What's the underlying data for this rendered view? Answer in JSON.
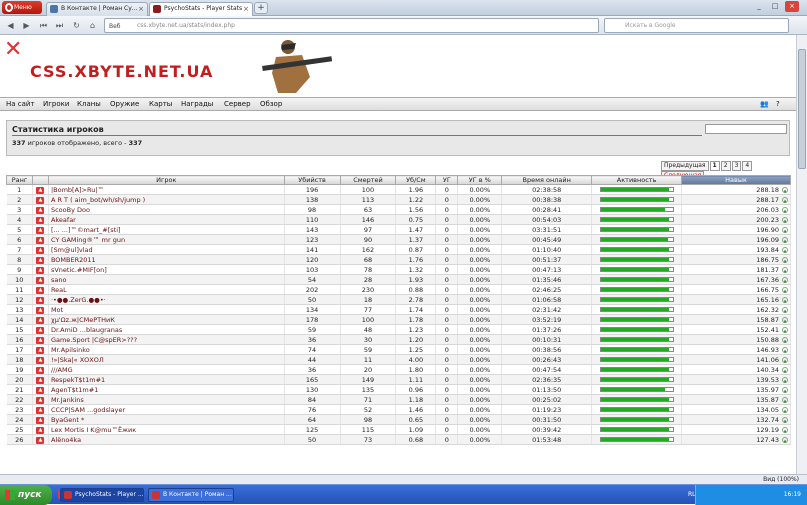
{
  "browser": {
    "menu_label": "Меню",
    "tabs": [
      {
        "label": "В Контакте | Роман Су...",
        "active": false
      },
      {
        "label": "PsychoStats - Player Stats",
        "active": true
      }
    ],
    "address_prefix": "Веб",
    "url": "css.xbyte.net.ua/stats/index.php",
    "search_placeholder": "Искать в Google"
  },
  "site": {
    "name": "CSS.XBYTE.NET.UA",
    "menu": [
      "На сайт",
      "Игроки",
      "Кланы",
      "Оружие",
      "Карты",
      "Награды",
      "Сервер",
      "Обзор"
    ],
    "panel_title": "Статистика игроков",
    "summary_count": "337",
    "summary_text": "игроков отображено, всего -",
    "summary_total": "337",
    "pager": {
      "prev": "Предыдущая",
      "pages": [
        "1",
        "2",
        "3",
        "4"
      ],
      "next": "Следующая"
    }
  },
  "table": {
    "headers": [
      "Ранг",
      "",
      "Игрок",
      "Убийств",
      "Смертей",
      "Уб/См",
      "УГ",
      "УГ в %",
      "Время онлайн",
      "Активность",
      "Навык"
    ],
    "rows": [
      [
        "1",
        "|Bomb[A]>Ru|™",
        "196",
        "100",
        "1.96",
        "0",
        "0.00%",
        "02:38:58",
        95,
        "288.18"
      ],
      [
        "2",
        "A R T ( aim_bot/wh/sh/jump )",
        "138",
        "113",
        "1.22",
        "0",
        "0.00%",
        "00:38:38",
        95,
        "288.17"
      ],
      [
        "3",
        "ScooBy Doo",
        "98",
        "63",
        "1.56",
        "0",
        "0.00%",
        "00:28:41",
        90,
        "206.03"
      ],
      [
        "4",
        "Akeafar",
        "110",
        "146",
        "0.75",
        "0",
        "0.00%",
        "00:54:03",
        95,
        "200.23"
      ],
      [
        "5",
        "[... ...]™©mart_#[sti]",
        "143",
        "97",
        "1.47",
        "0",
        "0.00%",
        "03:31:51",
        95,
        "196.90"
      ],
      [
        "6",
        "CY GAMing®™ mr gun",
        "123",
        "90",
        "1.37",
        "0",
        "0.00%",
        "00:45:49",
        94,
        "196.09"
      ],
      [
        "7",
        "[Sm@ul]vlad",
        "141",
        "162",
        "0.87",
        "0",
        "0.00%",
        "01:10:40",
        95,
        "193.84"
      ],
      [
        "8",
        "BOMBER2011",
        "120",
        "68",
        "1.76",
        "0",
        "0.00%",
        "00:51:37",
        95,
        "186.75"
      ],
      [
        "9",
        "sVnetic.#MIF[on]",
        "103",
        "78",
        "1.32",
        "0",
        "0.00%",
        "00:47:13",
        95,
        "181.37"
      ],
      [
        "10",
        "sano",
        "54",
        "28",
        "1.93",
        "0",
        "0.00%",
        "01:35:46",
        95,
        "167.36"
      ],
      [
        "11",
        "ReaL",
        "202",
        "230",
        "0.88",
        "0",
        "0.00%",
        "02:46:25",
        95,
        "166.75"
      ],
      [
        "12",
        "·•●●.ZerG.●●•·",
        "50",
        "18",
        "2.78",
        "0",
        "0.00%",
        "01:06:58",
        95,
        "165.16"
      ],
      [
        "13",
        "Mot",
        "134",
        "77",
        "1.74",
        "0",
        "0.00%",
        "02:31:42",
        95,
        "162.32"
      ],
      [
        "14",
        "χμ'Ωz.ж|СМеРТНиК",
        "178",
        "100",
        "1.78",
        "0",
        "0.00%",
        "03:52:19",
        95,
        "158.87"
      ],
      [
        "15",
        "Dr.AmiD ...blaugranas",
        "59",
        "48",
        "1.23",
        "0",
        "0.00%",
        "01:37:26",
        95,
        "152.41"
      ],
      [
        "16",
        "Game.Sport |C@spER>???",
        "36",
        "30",
        "1.20",
        "0",
        "0.00%",
        "00:10:31",
        95,
        "150.88"
      ],
      [
        "17",
        "Mr.Apilsinko",
        "74",
        "59",
        "1.25",
        "0",
        "0.00%",
        "00:38:56",
        95,
        "146.93"
      ],
      [
        "18",
        "!»|Ska|« ХОХОЛ",
        "44",
        "11",
        "4.00",
        "0",
        "0.00%",
        "00:26:43",
        95,
        "141.06"
      ],
      [
        "19",
        "///AMG",
        "36",
        "20",
        "1.80",
        "0",
        "0.00%",
        "00:47:54",
        95,
        "140.34"
      ],
      [
        "20",
        "RespekT$t1m#1",
        "165",
        "149",
        "1.11",
        "0",
        "0.00%",
        "02:36:35",
        95,
        "139.53"
      ],
      [
        "21",
        "AgenT$t1m#1",
        "130",
        "135",
        "0.96",
        "0",
        "0.00%",
        "01:13:50",
        90,
        "135.97"
      ],
      [
        "22",
        "Mr.Jankins",
        "84",
        "71",
        "1.18",
        "0",
        "0.00%",
        "00:25:02",
        "95",
        "135.87"
      ],
      [
        "23",
        "CCCP|SAM ...godslayer",
        "76",
        "52",
        "1.46",
        "0",
        "0.00%",
        "01:19:23",
        95,
        "134.05"
      ],
      [
        "24",
        "ByaGent *",
        "64",
        "98",
        "0.65",
        "0",
        "0.00%",
        "00:31:50",
        95,
        "132.74"
      ],
      [
        "25",
        "Lex Mortis I K@mu™Ёжик",
        "125",
        "115",
        "1.09",
        "0",
        "0.00%",
        "00:39:42",
        95,
        "129.19"
      ],
      [
        "26",
        "Alёno4ka",
        "50",
        "73",
        "0.68",
        "0",
        "0.00%",
        "01:53:48",
        95,
        "127.43"
      ]
    ]
  },
  "status": {
    "zoom": "Вид (100%)"
  },
  "taskbar": {
    "start_label": "пуск",
    "tasks": [
      "PsychoStats - Player ...",
      "В Контакте | Роман ..."
    ],
    "lang": "RL",
    "clock": "16:19"
  },
  "colors": {
    "brand_red": "#c21e1e",
    "activity": "#22aa22",
    "sorted_header": "#5f779e"
  }
}
